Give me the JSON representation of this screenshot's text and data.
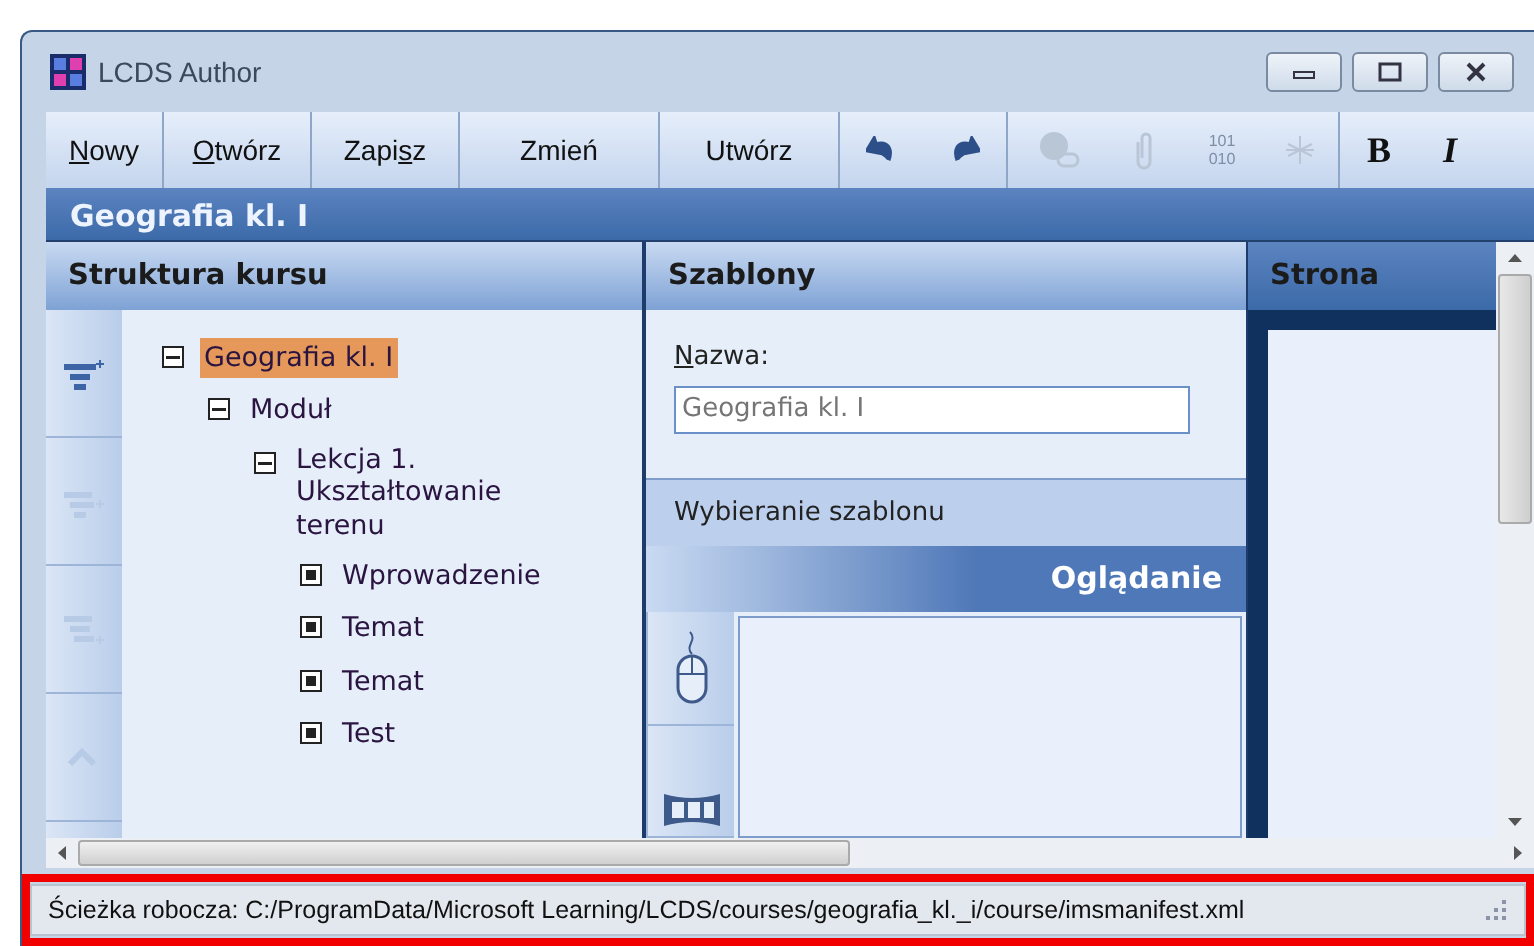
{
  "window": {
    "title": "LCDS Author"
  },
  "toolbar": [
    {
      "kind": "menu",
      "key": "N",
      "after": "owy"
    },
    {
      "kind": "menu",
      "key": "O",
      "after": "twórz"
    },
    {
      "kind": "menu",
      "before": "Zapi",
      "key": "s",
      "after": "z"
    },
    {
      "kind": "menu",
      "before": "Zmień"
    },
    {
      "kind": "menu",
      "before": "Utwórz"
    },
    {
      "kind": "undo",
      "disabled": false
    },
    {
      "kind": "redo",
      "disabled": false
    },
    {
      "kind": "link",
      "disabled": true
    },
    {
      "kind": "attach",
      "disabled": true
    },
    {
      "kind": "binary",
      "disabled": true,
      "lines": [
        "101",
        "010"
      ]
    },
    {
      "kind": "asterisk",
      "disabled": true
    },
    {
      "kind": "bold",
      "label": "B"
    },
    {
      "kind": "italic",
      "label": "I"
    }
  ],
  "course_title": "Geografia kl. I",
  "structure": {
    "title": "Struktura kursu",
    "tools": [
      {
        "kind": "add-level",
        "disabled": false
      },
      {
        "kind": "add-child",
        "disabled": true
      },
      {
        "kind": "add-sibling",
        "disabled": true
      },
      {
        "kind": "up",
        "disabled": true
      }
    ],
    "tree": [
      {
        "label": "Geografia kl. I",
        "selected": true,
        "expanded": true,
        "children": [
          {
            "label": "Moduł",
            "selected": false,
            "expanded": true,
            "children": [
              {
                "label": "Lekcja 1. Ukształtowanie terenu",
                "selected": false,
                "expanded": true,
                "children": [
                  {
                    "label": "Wprowadzenie",
                    "selected": false
                  },
                  {
                    "label": "Temat",
                    "selected": false
                  },
                  {
                    "label": "Temat",
                    "selected": false
                  },
                  {
                    "label": "Test",
                    "selected": false
                  }
                ]
              }
            ]
          }
        ]
      }
    ]
  },
  "templates": {
    "title": "Szablony",
    "name_label": {
      "key": "N",
      "after": "azwa:"
    },
    "name_placeholder": "Geografia kl. I",
    "choose_label": "Wybieranie szablonu",
    "preview_title": "Oglądanie",
    "preview_tools": [
      {
        "kind": "mouse"
      },
      {
        "kind": "film"
      }
    ]
  },
  "page_panel": {
    "title": "Strona"
  },
  "status_bar": {
    "text": "Ścieżka robocza: C:/ProgramData/Microsoft Learning/LCDS/courses/geografia_kl._i/course/imsmanifest.xml",
    "highlighted": true
  }
}
